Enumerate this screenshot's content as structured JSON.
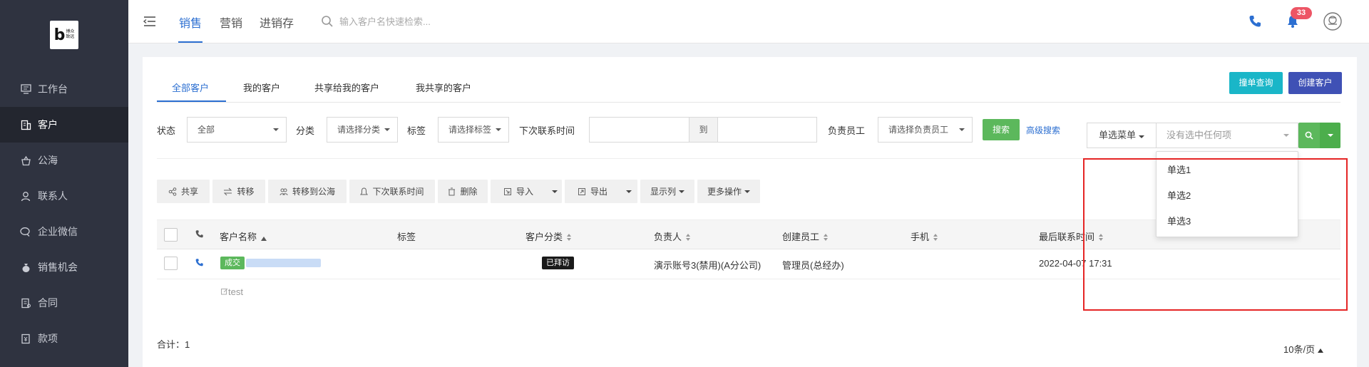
{
  "logo": {
    "mark": "b",
    "text_line1": "博众",
    "text_line2": "致远"
  },
  "sidebar": {
    "items": [
      {
        "label": "工作台",
        "icon": "monitor-icon"
      },
      {
        "label": "客户",
        "icon": "building-icon",
        "active": true
      },
      {
        "label": "公海",
        "icon": "basket-icon"
      },
      {
        "label": "联系人",
        "icon": "user-icon"
      },
      {
        "label": "企业微信",
        "icon": "chat-icon"
      },
      {
        "label": "销售机会",
        "icon": "money-bag-icon"
      },
      {
        "label": "合同",
        "icon": "document-icon"
      },
      {
        "label": "款项",
        "icon": "receipt-icon"
      }
    ]
  },
  "topbar": {
    "tabs": [
      "销售",
      "营销",
      "进销存"
    ],
    "search_placeholder": "输入客户名快速检索...",
    "notification_count": "33"
  },
  "tabs": [
    "全部客户",
    "我的客户",
    "共享给我的客户",
    "我共享的客户"
  ],
  "buttons": {
    "check_duplicate": "撞单查询",
    "create_customer": "创建客户"
  },
  "filters": {
    "status_label": "状态",
    "status_value": "全部",
    "category_label": "分类",
    "category_value": "请选择分类",
    "tag_label": "标签",
    "tag_value": "请选择标签",
    "next_contact_label": "下次联系时间",
    "date_sep": "到",
    "owner_label": "负责员工",
    "owner_value": "请选择负责员工",
    "search_btn": "搜索",
    "advanced": "高级搜索"
  },
  "toolbar": {
    "share": "共享",
    "transfer": "转移",
    "to_pool": "转移到公海",
    "next_contact": "下次联系时间",
    "delete": "删除",
    "import": "导入",
    "export": "导出",
    "columns": "显示列",
    "more": "更多操作"
  },
  "table": {
    "headers": {
      "name": "客户名称",
      "tags": "标签",
      "category": "客户分类",
      "owner": "负责人",
      "creator": "创建员工",
      "mobile": "手机",
      "last_contact": "最后联系时间"
    },
    "rows": [
      {
        "status_tag": "成交",
        "category_tag": "已拜访",
        "owner": "演示账号3(禁用)(A分公司)",
        "creator": "管理员(总经办)",
        "last_contact": "2022-04-07 17:31",
        "note": "test"
      }
    ]
  },
  "footer": {
    "total": "合计：1",
    "page_size": "10条/页"
  },
  "single_select": {
    "menu_label": "单选菜单",
    "placeholder": "没有选中任何项",
    "options": [
      "单选1",
      "单选2",
      "单选3"
    ]
  },
  "colors": {
    "sidebar": "#2f3340",
    "accent": "#2c6fd1",
    "green": "#5cb85c",
    "teal": "#1ab6c8",
    "indigo": "#3f51b5",
    "highlight": "#e52525"
  }
}
